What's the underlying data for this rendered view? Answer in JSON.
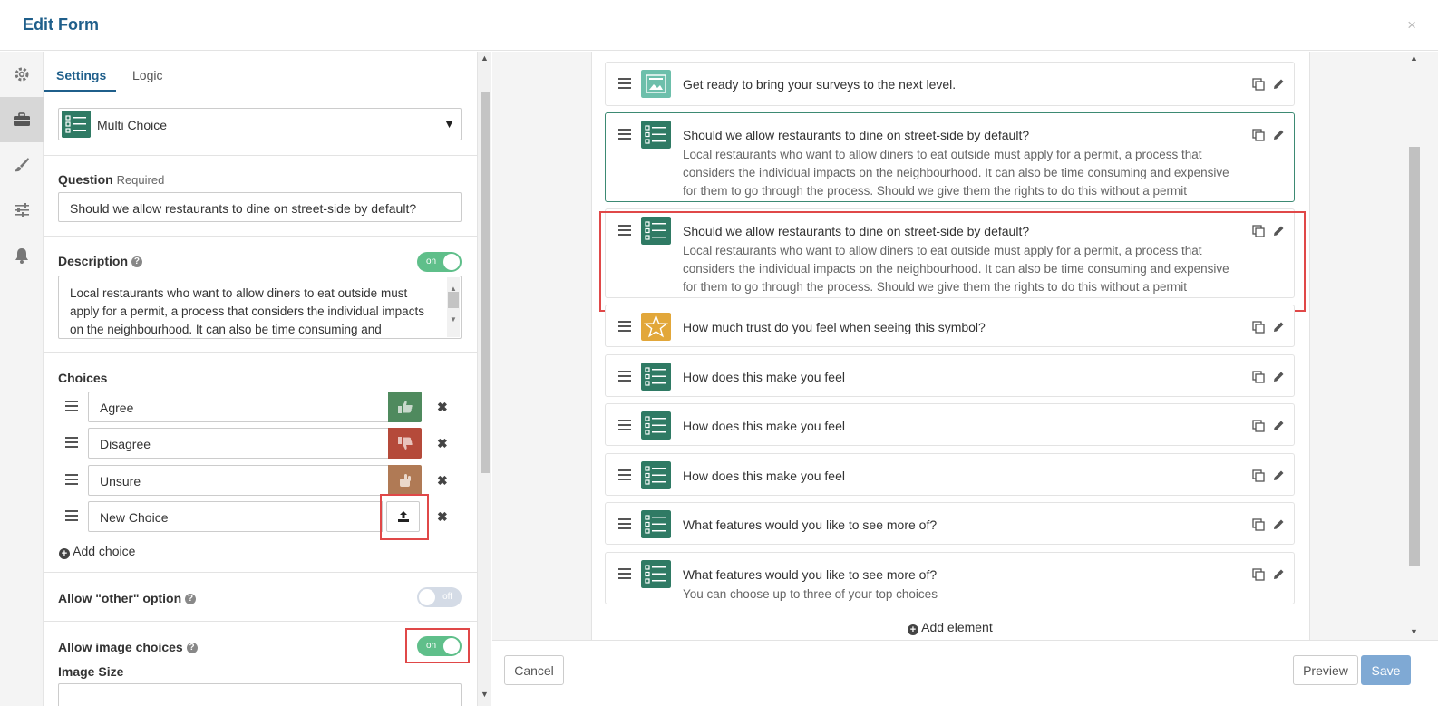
{
  "header": {
    "title": "Edit Form",
    "close_glyph": "×"
  },
  "sidebar_icons": [
    "gear-icon",
    "briefcase-icon",
    "brush-icon",
    "sliders-icon",
    "bell-icon"
  ],
  "settings": {
    "tabs": [
      "Settings",
      "Logic"
    ],
    "element_type": "Multi Choice",
    "question_label": "Question",
    "question_required": "Required",
    "question_value": "Should we allow restaurants to dine on street-side by default?",
    "description_label": "Description",
    "description_toggle": "on",
    "description_value": "Local restaurants who want to allow diners to eat outside must apply for a permit, a process that considers the individual impacts on the neighbourhood.  It can also be time consuming and expensive for them to go through the process.",
    "choices_label": "Choices",
    "choices": [
      {
        "label": "Agree",
        "image": "thumbs-up",
        "color": "#4f8a5e"
      },
      {
        "label": "Disagree",
        "image": "thumbs-down",
        "color": "#b54a3a"
      },
      {
        "label": "Unsure",
        "image": "hand",
        "color": "#b07a55"
      },
      {
        "label": "New Choice",
        "image": "upload",
        "color": "#ffffff"
      }
    ],
    "add_choice": "Add choice",
    "allow_other_label": "Allow \"other\" option",
    "allow_other_toggle": "off",
    "allow_image_label": "Allow image choices",
    "allow_image_toggle": "on",
    "image_size_label": "Image Size"
  },
  "form_elements": [
    {
      "title": "Get ready to bring your surveys to the next level.",
      "desc": "",
      "icon": "image-block",
      "color": "#6dbfab"
    },
    {
      "title": "Should we allow restaurants to dine on street-side by default?",
      "desc": "Local restaurants who want to allow diners to eat outside must apply for a permit, a process that considers the individual impacts on the neighbourhood. It can also be time consuming and expensive for them to go through the process. Should we give them the rights to do this without a permit",
      "icon": "multi-choice",
      "color": "#2f7a64"
    },
    {
      "title": "Should we allow restaurants to dine on street-side by default?",
      "desc": "Local restaurants who want to allow diners to eat outside must apply for a permit, a process that considers the individual impacts on the neighbourhood. It can also be time consuming and expensive for them to go through the process. Should we give them the rights to do this without a permit",
      "icon": "multi-choice",
      "color": "#2f7a64"
    },
    {
      "title": "How much trust do you feel when seeing this symbol?",
      "desc": "",
      "icon": "star",
      "color": "#e2a73a"
    },
    {
      "title": "How does this make you feel",
      "desc": "",
      "icon": "multi-choice",
      "color": "#2f7a64"
    },
    {
      "title": "How does this make you feel",
      "desc": "",
      "icon": "multi-choice",
      "color": "#2f7a64"
    },
    {
      "title": "How does this make you feel",
      "desc": "",
      "icon": "multi-choice",
      "color": "#2f7a64"
    },
    {
      "title": "What features would you like to see more of?",
      "desc": "",
      "icon": "multi-choice",
      "color": "#2f7a64"
    },
    {
      "title": "What features would you like to see more of?",
      "desc": "You can choose up to three of your top choices",
      "icon": "multi-choice",
      "color": "#2f7a64"
    }
  ],
  "add_element": "Add element",
  "footer": {
    "cancel": "Cancel",
    "preview": "Preview",
    "save": "Save"
  },
  "colors": {
    "accent": "#1f5f8b",
    "toggle_on": "#5fbf8a",
    "highlight": "#e04848"
  }
}
